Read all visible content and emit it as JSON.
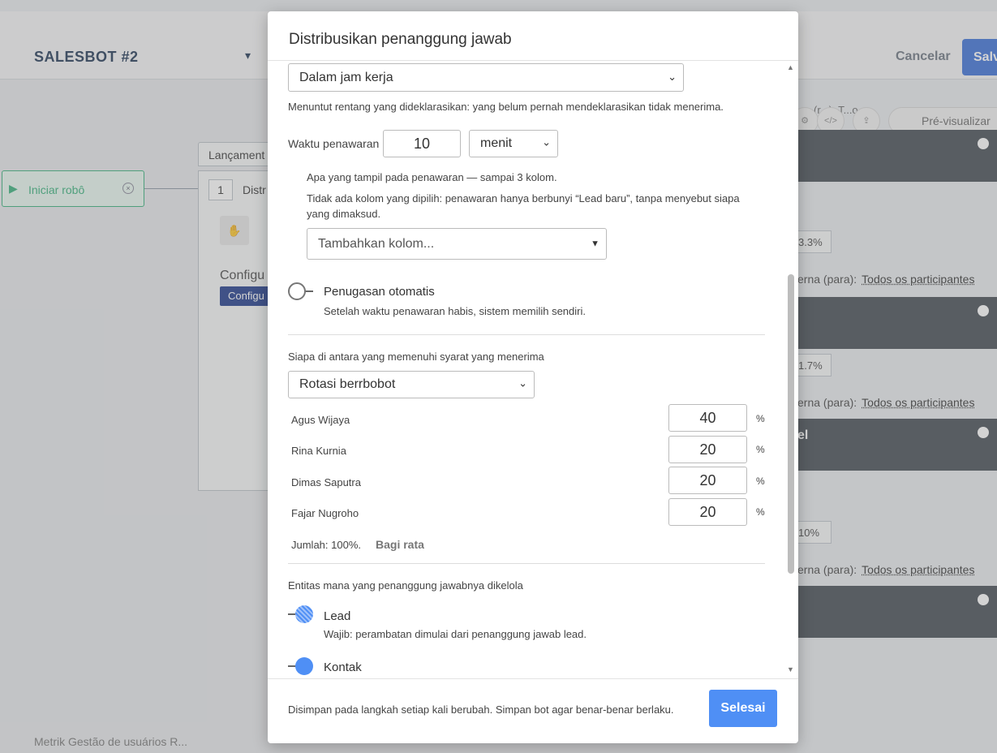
{
  "background": {
    "bot_title": "SALESBOT #2",
    "cancel_label": "Cancelar",
    "save_label": "Salv",
    "start_node_label": "Iniciar robô",
    "launch_tab_label": "Lançament",
    "launch_step_number": "1",
    "launch_step_label": "Distr",
    "launch_config_text": "Configu",
    "launch_config_button": "Configu",
    "right_panel": {
      "toolbar_title": "(r...): T...o",
      "code_icon_label": "</>",
      "preview_label": "Pré-visualizar",
      "rows": [
        {
          "percent": "3.3%",
          "target_prefix": "erna",
          "target_label": "(para):",
          "target_value": "Todos os participantes"
        },
        {
          "percent": "1.7%",
          "target_prefix": "erna",
          "target_label": "(para):",
          "target_value": "Todos os participantes"
        },
        {
          "percent": "10%",
          "target_prefix": "erna",
          "target_label": "(para):",
          "target_value": "Todos os participantes"
        }
      ],
      "dark_label": "el"
    },
    "bottom_left_text": "Metrik Gestão de usuários R..."
  },
  "modal": {
    "title": "Distribusikan penanggung jawab",
    "schedule_select": "Dalam jam kerja",
    "schedule_hint": "Menuntut rentang yang dideklarasikan: yang belum pernah mendeklarasikan tidak menerima.",
    "offer_time_label": "Waktu penawaran",
    "offer_time_value": "10",
    "offer_time_unit": "menit",
    "columns_hint": "Apa yang tampil pada penawaran — sampai 3 kolom.",
    "columns_empty_hint": "Tidak ada kolom yang dipilih: penawaran hanya berbunyi “Lead baru”, tanpa menyebut siapa yang dimaksud.",
    "add_column_placeholder": "Tambahkan kolom...",
    "auto_assign_label": "Penugasan otomatis",
    "auto_assign_hint": "Setelah waktu penawaran habis, sistem memilih sendiri.",
    "auto_assign_enabled": false,
    "who_receives_label": "Siapa di antara yang memenuhi syarat yang menerima",
    "rotation_select": "Rotasi berrbobot",
    "weights": [
      {
        "name": "Agus Wijaya",
        "value": "40",
        "unit": "%"
      },
      {
        "name": "Rina Kurnia",
        "value": "20",
        "unit": "%"
      },
      {
        "name": "Dimas Saputra",
        "value": "20",
        "unit": "%"
      },
      {
        "name": "Fajar Nugroho",
        "value": "20",
        "unit": "%"
      }
    ],
    "total_text": "Jumlah: 100%.",
    "split_even_label": "Bagi rata",
    "entities_label": "Entitas mana yang penanggung jawabnya dikelola",
    "entity_lead_label": "Lead",
    "entity_lead_hint": "Wajib: perambatan dimulai dari penanggung jawab lead.",
    "entity_lead_enabled": true,
    "entity_contact_label": "Kontak",
    "entity_contact_enabled": true,
    "footer_text": "Disimpan pada langkah setiap kali berubah. Simpan bot agar benar-benar berlaku.",
    "done_label": "Selesai"
  }
}
